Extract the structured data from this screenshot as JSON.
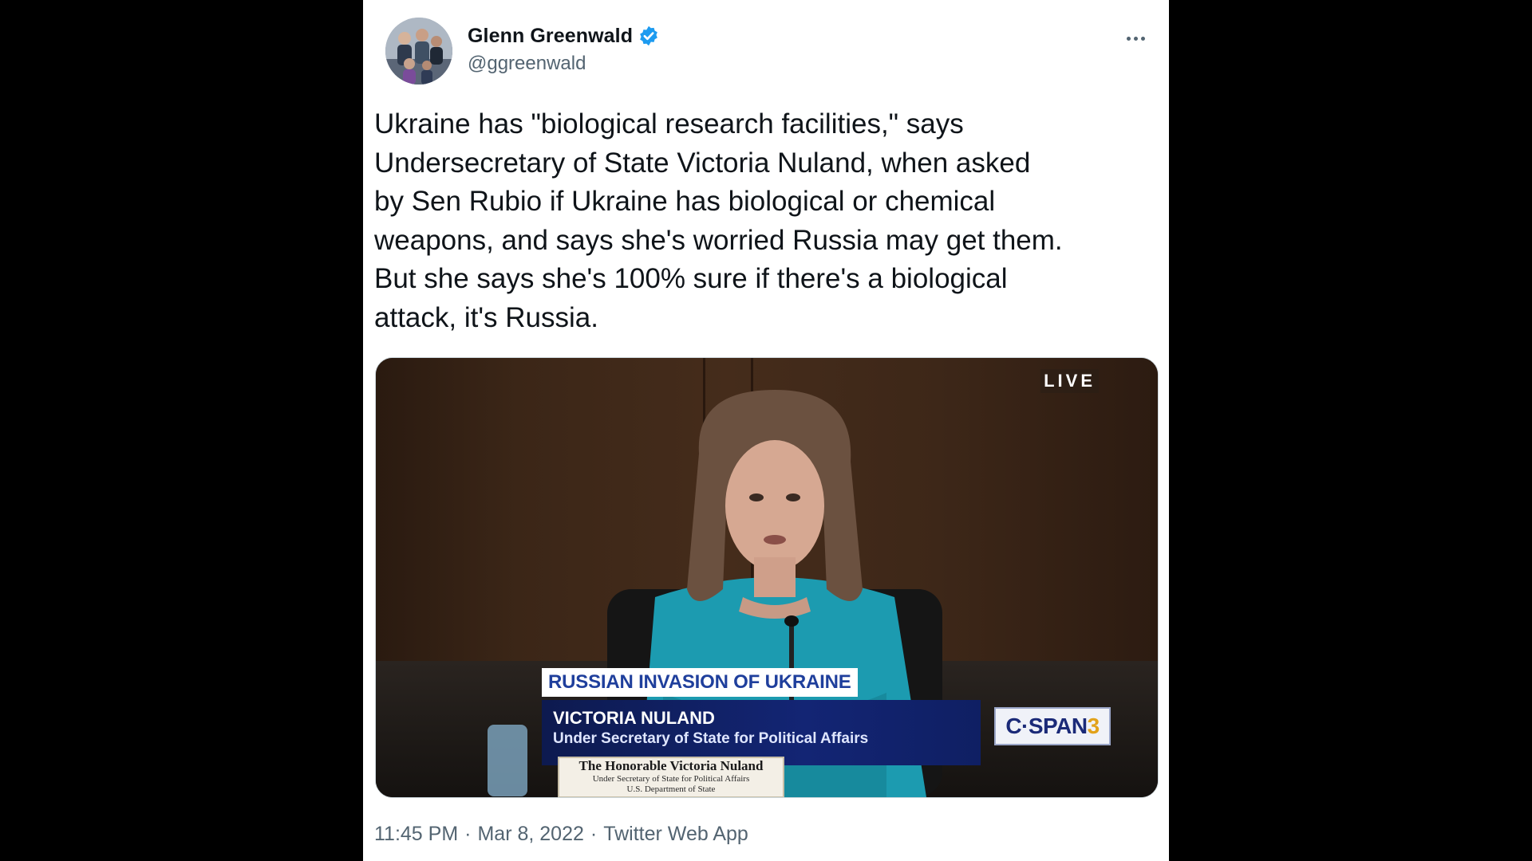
{
  "tweet": {
    "author": {
      "name": "Glenn Greenwald",
      "handle": "@ggreenwald",
      "verified": true,
      "verified_color": "#1d9bf0"
    },
    "more_icon": "more-horizontal-icon",
    "text": "Ukraine has \"biological research facilities,\" says\nUndersecretary of State Victoria Nuland, when asked\nby Sen Rubio if Ukraine has biological or chemical\nweapons, and says she's worried Russia may get them.\nBut she says she's 100% sure if there's a biological\nattack, it's Russia.",
    "media": {
      "type": "video",
      "live_label": "LIVE",
      "topic": "RUSSIAN INVASION OF UKRAINE",
      "speaker_name": "VICTORIA NULAND",
      "speaker_title": "Under Secretary of State for Political Affairs",
      "network_main": "C·SPAN",
      "network_number": "3",
      "nameplate_line1": "The Honorable Victoria Nuland",
      "nameplate_line2": "Under Secretary of State for Political Affairs",
      "nameplate_line3": "U.S. Department of State"
    },
    "meta": {
      "time": "11:45 PM",
      "date": "Mar 8, 2022",
      "source": "Twitter Web App",
      "separator": "·"
    }
  },
  "colors": {
    "background": "#000000",
    "card": "#ffffff",
    "text_primary": "#0f1419",
    "text_secondary": "#536471",
    "topic_text": "#1f3f9c",
    "name_bar": "#132574",
    "network_accent": "#e2a21a"
  }
}
